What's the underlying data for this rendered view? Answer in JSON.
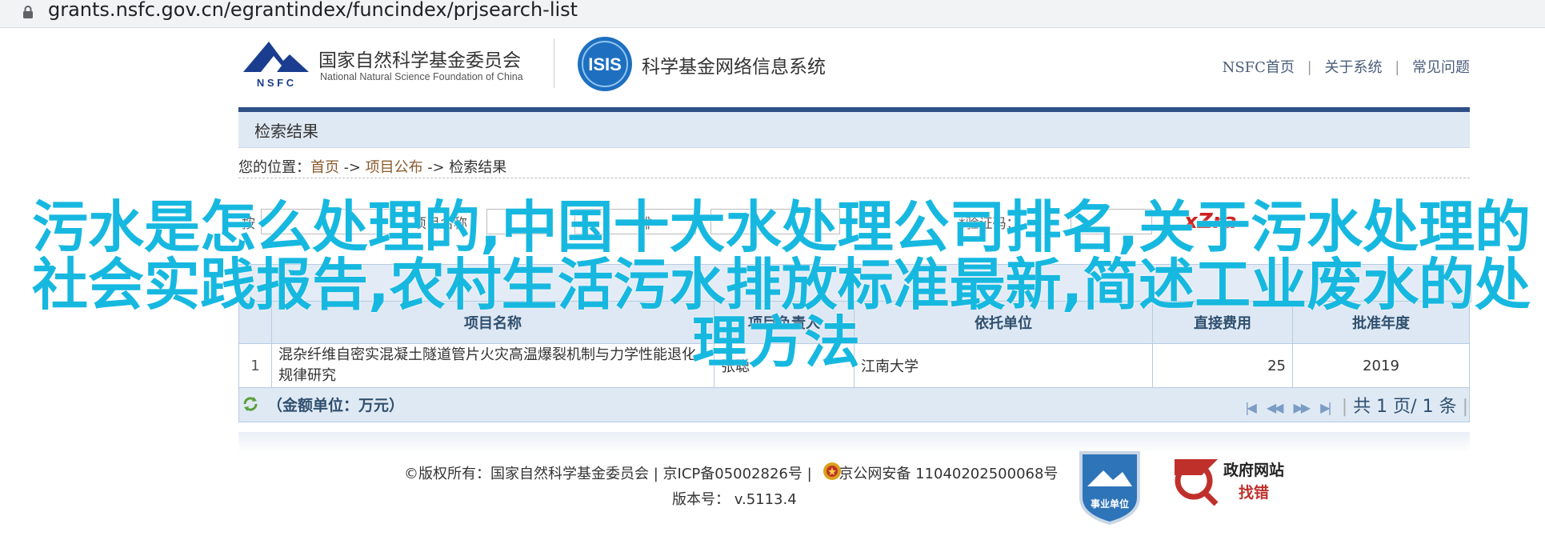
{
  "browser": {
    "url": "grants.nsfc.gov.cn/egrantindex/funcindex/prjsearch-list"
  },
  "header": {
    "org_name_cn": "国家自然科学基金委员会",
    "org_name_en": "National Natural Science Foundation of China",
    "logo_text": "N S F C",
    "isis_logo_text": "ISIS",
    "system_name": "科学基金网络信息系统",
    "links": [
      "NSFC首页",
      "关于系统",
      "常见问题"
    ]
  },
  "band": {
    "title": "检索结果"
  },
  "breadcrumb": {
    "prefix": "您的位置：",
    "items": [
      "首页",
      "项目公布",
      "检索结果"
    ],
    "sep": "->"
  },
  "form": {
    "label1": "按",
    "label2": "项目名称",
    "label3": "排",
    "captcha_label": "*验证码：",
    "captcha": "xZra"
  },
  "table": {
    "columns": [
      "",
      "项目名称",
      "项目负责人",
      "依托单位",
      "直接费用",
      "批准年度"
    ],
    "rows": [
      {
        "index": "1",
        "name": "混杂纤维自密实混凝土隧道管片火灾高温爆裂机制与力学性能退化规律研究",
        "leader": "张聪",
        "unit": "江南大学",
        "cost": "25",
        "year": "2019"
      }
    ]
  },
  "pager": {
    "amount_unit": "（金额单位：万元）",
    "text": "共 1 页/ 1 条"
  },
  "footer": {
    "copyright": "©版权所有：国家自然科学基金委员会 | 京ICP备05002826号 | ",
    "police": "京公网安备 11040202500068号",
    "version": "版本号：  v.5113.4",
    "badge_unit": "事业单位",
    "gov_site_line1": "政府网站",
    "gov_site_line2": "找错"
  },
  "overlay": {
    "lines": [
      "污水是怎么处理的,中国十大水处理公司排名,关于污水处理的",
      "社会实践报告,农村生活污水排放标准最新,简述工业废水的处",
      "理方法"
    ]
  },
  "colors": {
    "accent": "#2f4f88",
    "overlay": "#17b8e0",
    "link": "#8a5a2c"
  }
}
